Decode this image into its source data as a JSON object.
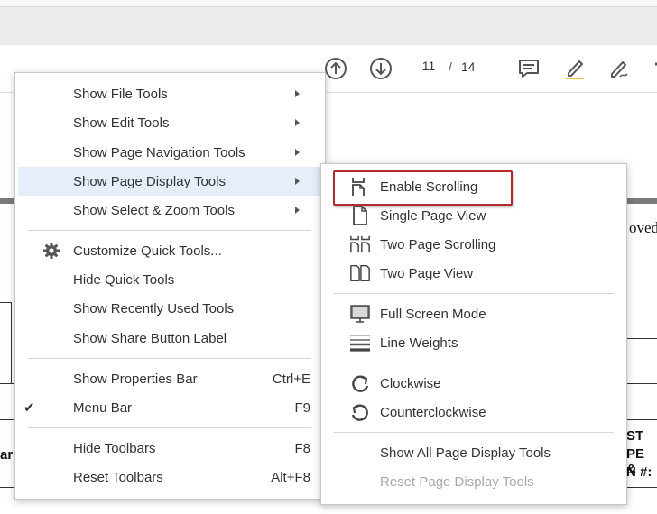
{
  "toolbar": {
    "page_current": "11",
    "page_separator": "/",
    "page_total": "14",
    "icons": [
      "arrow-up-circle-icon",
      "arrow-down-circle-icon",
      "comment-icon",
      "highlight-pen-icon",
      "sign-pen-icon"
    ]
  },
  "document": {
    "fragment_right_top": "oved",
    "fragment_left": "ar",
    "fragment_right_1": "ST",
    "fragment_right_2": "PE &",
    "fragment_right_3": "N #:"
  },
  "main_menu": {
    "items": [
      {
        "label": "Show File Tools",
        "submenu": true
      },
      {
        "label": "Show Edit Tools",
        "submenu": true
      },
      {
        "label": "Show Page Navigation Tools",
        "submenu": true
      },
      {
        "label": "Show Page Display Tools",
        "submenu": true,
        "highlighted": true
      },
      {
        "label": "Show Select & Zoom Tools",
        "submenu": true
      },
      {
        "label": "Customize Quick Tools...",
        "icon": "gear-icon"
      },
      {
        "label": "Hide Quick Tools"
      },
      {
        "label": "Show Recently Used Tools"
      },
      {
        "label": "Show Share Button Label"
      },
      {
        "label": "Show Properties Bar",
        "shortcut": "Ctrl+E"
      },
      {
        "label": "Menu Bar",
        "shortcut": "F9",
        "checked": true,
        "check_mark": "✔"
      },
      {
        "label": "Hide Toolbars",
        "shortcut": "F8"
      },
      {
        "label": "Reset Toolbars",
        "shortcut": "Alt+F8"
      }
    ]
  },
  "sub_menu": {
    "items": [
      {
        "label": "Enable Scrolling",
        "icon": "enable-scrolling-icon",
        "focused": true
      },
      {
        "label": "Single Page View",
        "icon": "single-page-icon"
      },
      {
        "label": "Two Page Scrolling",
        "icon": "two-page-scrolling-icon"
      },
      {
        "label": "Two Page View",
        "icon": "two-page-view-icon"
      },
      {
        "label": "Full Screen Mode",
        "icon": "monitor-icon"
      },
      {
        "label": "Line Weights",
        "icon": "line-weights-icon"
      },
      {
        "label": "Clockwise",
        "icon": "rotate-clockwise-icon"
      },
      {
        "label": "Counterclockwise",
        "icon": "rotate-counterclockwise-icon"
      },
      {
        "label": "Show All Page Display Tools"
      },
      {
        "label": "Reset Page Display Tools",
        "disabled": true
      }
    ]
  }
}
